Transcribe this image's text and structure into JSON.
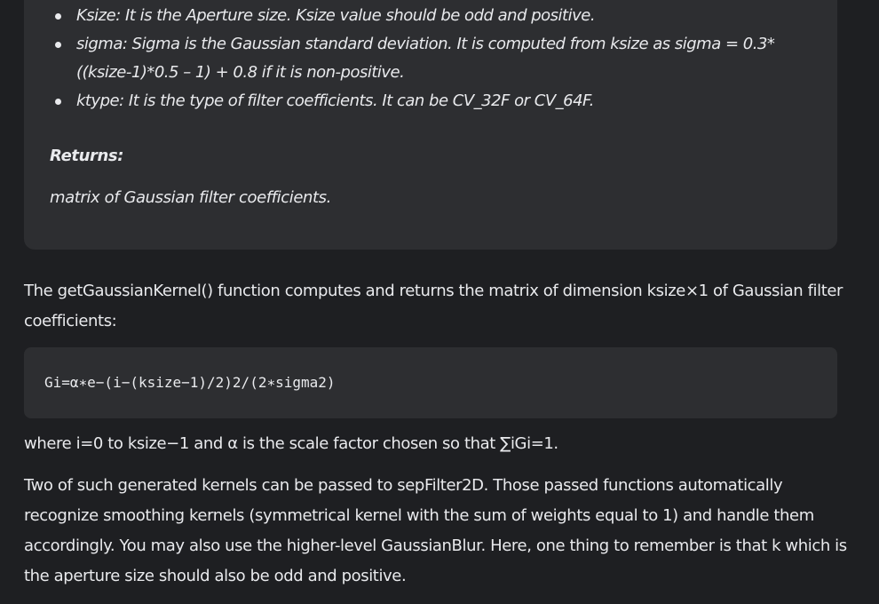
{
  "params": [
    {
      "text": "Ksize: It is the Aperture size. Ksize value should be odd and positive."
    },
    {
      "text": "sigma: Sigma is the Gaussian standard deviation. It is computed from ksize as sigma = 0.3*((ksize-1)*0.5 – 1) + 0.8 if it is non-positive."
    },
    {
      "text": "ktype: It is the type of filter coefficients. It can be CV_32F or CV_64F."
    }
  ],
  "returns": {
    "heading": "Returns:",
    "text": "matrix of Gaussian filter coefficients."
  },
  "intro": "The getGaussianKernel() function computes and returns the matrix of dimension ksize×1 of Gaussian filter coefficients:",
  "formula": "Gi=α∗e−(i−(ksize−1)/2)2/(2∗sigma2)",
  "where_text": "where i=0 to ksize−1 and α is the scale factor chosen so that ∑iGi=1.",
  "final_paragraph": "Two of such generated kernels can be passed to sepFilter2D. Those passed functions automatically recognize smoothing kernels (symmetrical kernel with the sum of weights equal to 1) and handle them accordingly. You may also use the higher-level GaussianBlur. Here, one thing to remember is that k which is the aperture size should also be odd and positive."
}
